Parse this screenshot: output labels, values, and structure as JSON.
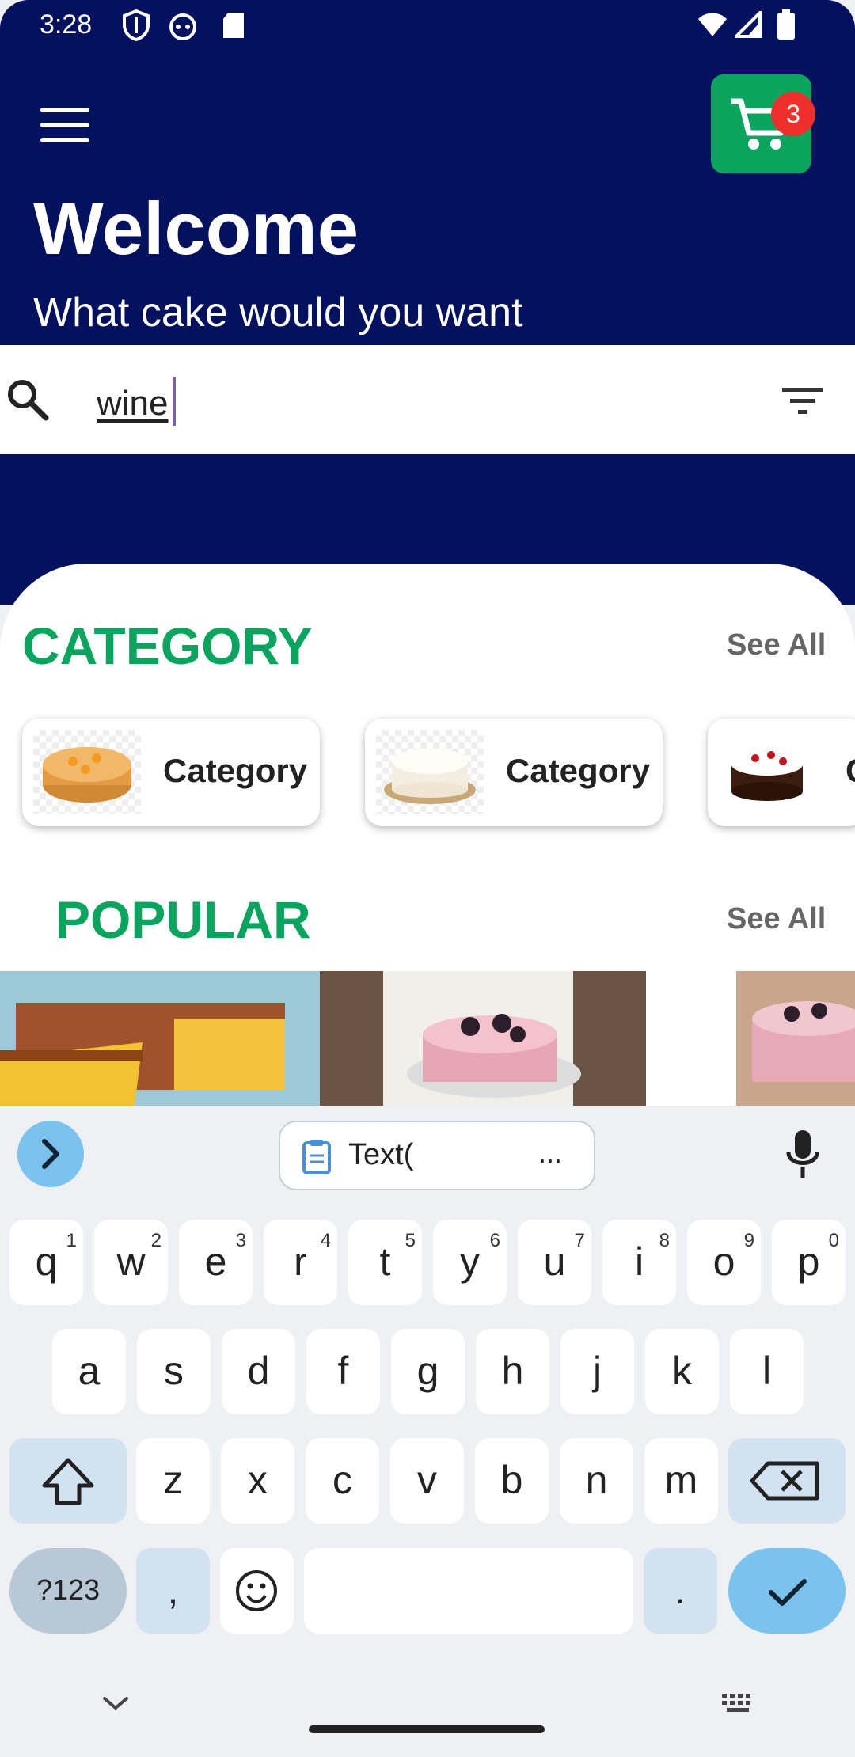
{
  "status_bar": {
    "time": "3:28"
  },
  "header": {
    "title": "Welcome",
    "subtitle": "What cake would you want",
    "cart_count": "3"
  },
  "search": {
    "value": "wine"
  },
  "category": {
    "title": "CATEGORY",
    "see_all": "See All",
    "items": [
      {
        "label": "Category"
      },
      {
        "label": "Category"
      },
      {
        "label": "C"
      }
    ]
  },
  "popular": {
    "title": "POPULAR",
    "see_all": "See All"
  },
  "keyboard": {
    "clipboard_text": "Text(",
    "clipboard_more": "...",
    "row1": [
      "q",
      "w",
      "e",
      "r",
      "t",
      "y",
      "u",
      "i",
      "o",
      "p"
    ],
    "row1_nums": [
      "1",
      "2",
      "3",
      "4",
      "5",
      "6",
      "7",
      "8",
      "9",
      "0"
    ],
    "row2": [
      "a",
      "s",
      "d",
      "f",
      "g",
      "h",
      "j",
      "k",
      "l"
    ],
    "row3": [
      "z",
      "x",
      "c",
      "v",
      "b",
      "n",
      "m"
    ],
    "symbols_key": "?123",
    "comma": ",",
    "period": "."
  },
  "colors": {
    "brand_navy": "#03115f",
    "accent_green": "#0ba45f",
    "badge_red": "#ee2f2b"
  }
}
